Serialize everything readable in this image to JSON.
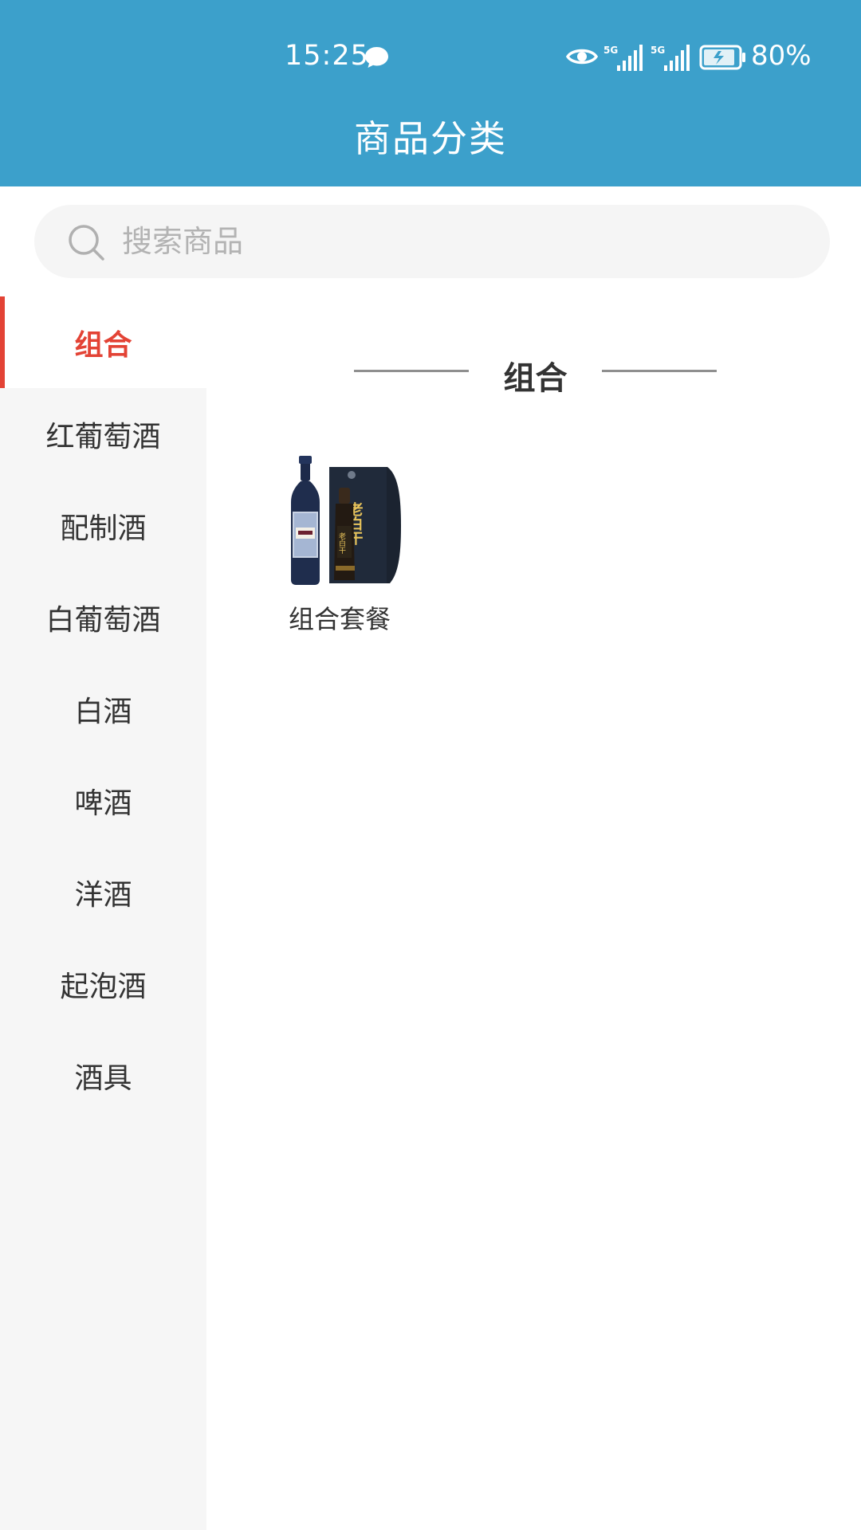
{
  "status_bar": {
    "time": "15:25",
    "network_1": "5G",
    "network_2": "5G",
    "battery": "80%"
  },
  "header": {
    "title": "商品分类"
  },
  "search": {
    "placeholder": "搜索商品"
  },
  "sidebar": {
    "items": [
      {
        "label": "组合",
        "active": true
      },
      {
        "label": "红葡萄酒",
        "active": false
      },
      {
        "label": "配制酒",
        "active": false
      },
      {
        "label": "白葡萄酒",
        "active": false
      },
      {
        "label": "白酒",
        "active": false
      },
      {
        "label": "啤酒",
        "active": false
      },
      {
        "label": "洋酒",
        "active": false
      },
      {
        "label": "起泡酒",
        "active": false
      },
      {
        "label": "酒具",
        "active": false
      }
    ]
  },
  "main": {
    "section_title": "组合",
    "products": [
      {
        "name": "组合套餐",
        "box_text": "老白干"
      }
    ]
  },
  "colors": {
    "header_bg": "#3ca0cb",
    "accent": "#e34335",
    "sidebar_bg": "#f6f6f6"
  },
  "icons": {
    "message": "message-bubble-icon",
    "eye": "eye-icon",
    "signal": "signal-icon",
    "battery": "battery-charging-icon",
    "search": "search-icon"
  }
}
